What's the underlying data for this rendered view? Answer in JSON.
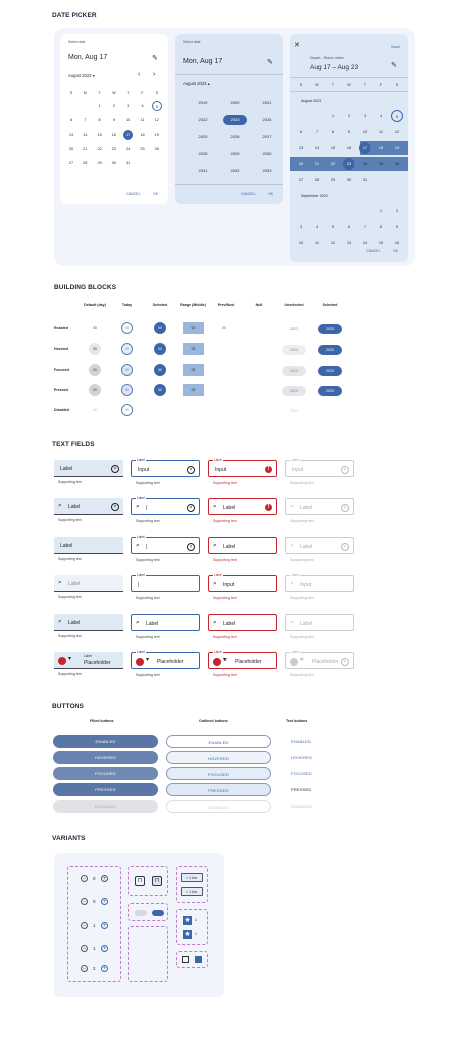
{
  "sections": {
    "date_picker": "DATE PICKER",
    "building_blocks": "BUILDING BLOCKS",
    "text_fields": "TEXT FIELDS",
    "buttons": "BUTTONS",
    "variants": "VARIANTS"
  },
  "dp1": {
    "select": "Select date",
    "date": "Mon, Aug 17",
    "month": "August 2023",
    "weekdays": [
      "S",
      "M",
      "T",
      "W",
      "T",
      "F",
      "S"
    ],
    "rows": [
      [
        "",
        "",
        "1",
        "2",
        "3",
        "4",
        "5"
      ],
      [
        "6",
        "7",
        "8",
        "9",
        "10",
        "11",
        "12"
      ],
      [
        "13",
        "14",
        "15",
        "16",
        "17",
        "18",
        "19"
      ],
      [
        "20",
        "21",
        "22",
        "23",
        "24",
        "25",
        "26"
      ],
      [
        "27",
        "28",
        "29",
        "30",
        "31",
        "",
        ""
      ]
    ],
    "cancel": "CANCEL",
    "ok": "OK"
  },
  "dp2": {
    "select": "Select date",
    "date": "Mon, Aug 17",
    "month": "August 2023",
    "years": [
      [
        "2019",
        "2020",
        "2021"
      ],
      [
        "2022",
        "2023",
        "2024"
      ],
      [
        "2025",
        "2026",
        "2027"
      ],
      [
        "2028",
        "2029",
        "2030"
      ],
      [
        "2031",
        "2032",
        "2033"
      ]
    ],
    "cancel": "CANCEL",
    "ok": "OK"
  },
  "dp3": {
    "depart": "Depart - Return dates",
    "range": "Aug 17 – Aug 23",
    "save": "Save",
    "weekdays": [
      "S",
      "M",
      "T",
      "W",
      "T",
      "F",
      "S"
    ],
    "month1": "August 2023",
    "rows": [
      [
        "",
        "",
        "1",
        "2",
        "3",
        "4",
        "5"
      ],
      [
        "6",
        "7",
        "8",
        "9",
        "10",
        "11",
        "12"
      ],
      [
        "13",
        "14",
        "15",
        "16",
        "17",
        "18",
        "19"
      ],
      [
        "20",
        "21",
        "22",
        "23",
        "24",
        "25",
        "26"
      ],
      [
        "27",
        "28",
        "29",
        "30",
        "31",
        "",
        ""
      ]
    ],
    "month2": "September 2023",
    "rows2": [
      [
        "",
        "",
        "",
        "",
        "",
        "1",
        "2"
      ],
      [
        "3",
        "4",
        "5",
        "6",
        "7",
        "8",
        "9"
      ],
      [
        "10",
        "11",
        "12",
        "13",
        "14",
        "15",
        "16"
      ]
    ],
    "cancel": "CANCEL",
    "ok": "OK"
  },
  "bb": {
    "headers": [
      "Default (day)",
      "Today",
      "Selected",
      "Range (Middle)",
      "Prev/Next",
      "Null",
      "Unselected",
      "Selected"
    ],
    "rows": [
      "Enabled",
      "Hovered",
      "Focused",
      "Pressed",
      "Disabled"
    ],
    "day": "00",
    "year": "2023"
  },
  "tf": {
    "label": "Label",
    "input": "Input",
    "support": "Supporting text",
    "placeholder": "Placeholder",
    "cursor": "|"
  },
  "buttons": {
    "filled_title": "Filled buttons",
    "outlined_title": "Outlined buttons",
    "text_title": "Text buttons",
    "states": [
      "ENABLED",
      "HOVERED",
      "FOCUSED",
      "PRESSED",
      "DISABLED"
    ]
  },
  "variants": {
    "steppers": [
      "0",
      "0",
      "1",
      "1",
      "2"
    ],
    "km": "< 1 km.",
    "star": "1"
  },
  "colors": {
    "primary": "#3d66a8",
    "surface": "#e3ecf7",
    "error": "#c4262e"
  }
}
